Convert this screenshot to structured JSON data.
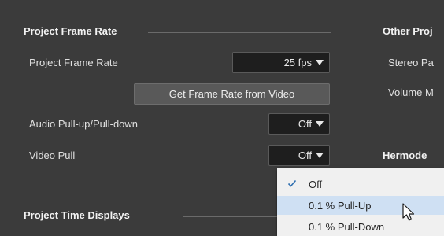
{
  "left": {
    "frame_rate_section": {
      "title": "Project Frame Rate",
      "project_frame_rate_label": "Project Frame Rate",
      "project_frame_rate_value": "25 fps",
      "get_frame_rate_button": "Get Frame Rate from Video",
      "audio_pull_label": "Audio Pull-up/Pull-down",
      "audio_pull_value": "Off",
      "video_pull_label": "Video Pull",
      "video_pull_value": "Off"
    },
    "time_displays_section": {
      "title": "Project Time Displays"
    }
  },
  "right": {
    "other_section_title": "Other Proj",
    "stereo_label": "Stereo Pa",
    "volume_label": "Volume M",
    "hermode_title": "Hermode"
  },
  "dropdown": {
    "options": [
      "Off",
      "0.1 % Pull-Up",
      "0.1 % Pull-Down"
    ],
    "selected": "Off",
    "hovered": "0.1 % Pull-Up"
  },
  "colors": {
    "background": "#3b3b3b",
    "field": "#1e1e1e",
    "button": "#595959",
    "menu_bg": "#f0f0f0",
    "menu_highlight": "#cfe0f3",
    "checkmark": "#2f6fb0"
  },
  "icons": {
    "caret": "chevron-down-icon",
    "check": "checkmark-icon",
    "cursor": "mouse-pointer-icon"
  }
}
